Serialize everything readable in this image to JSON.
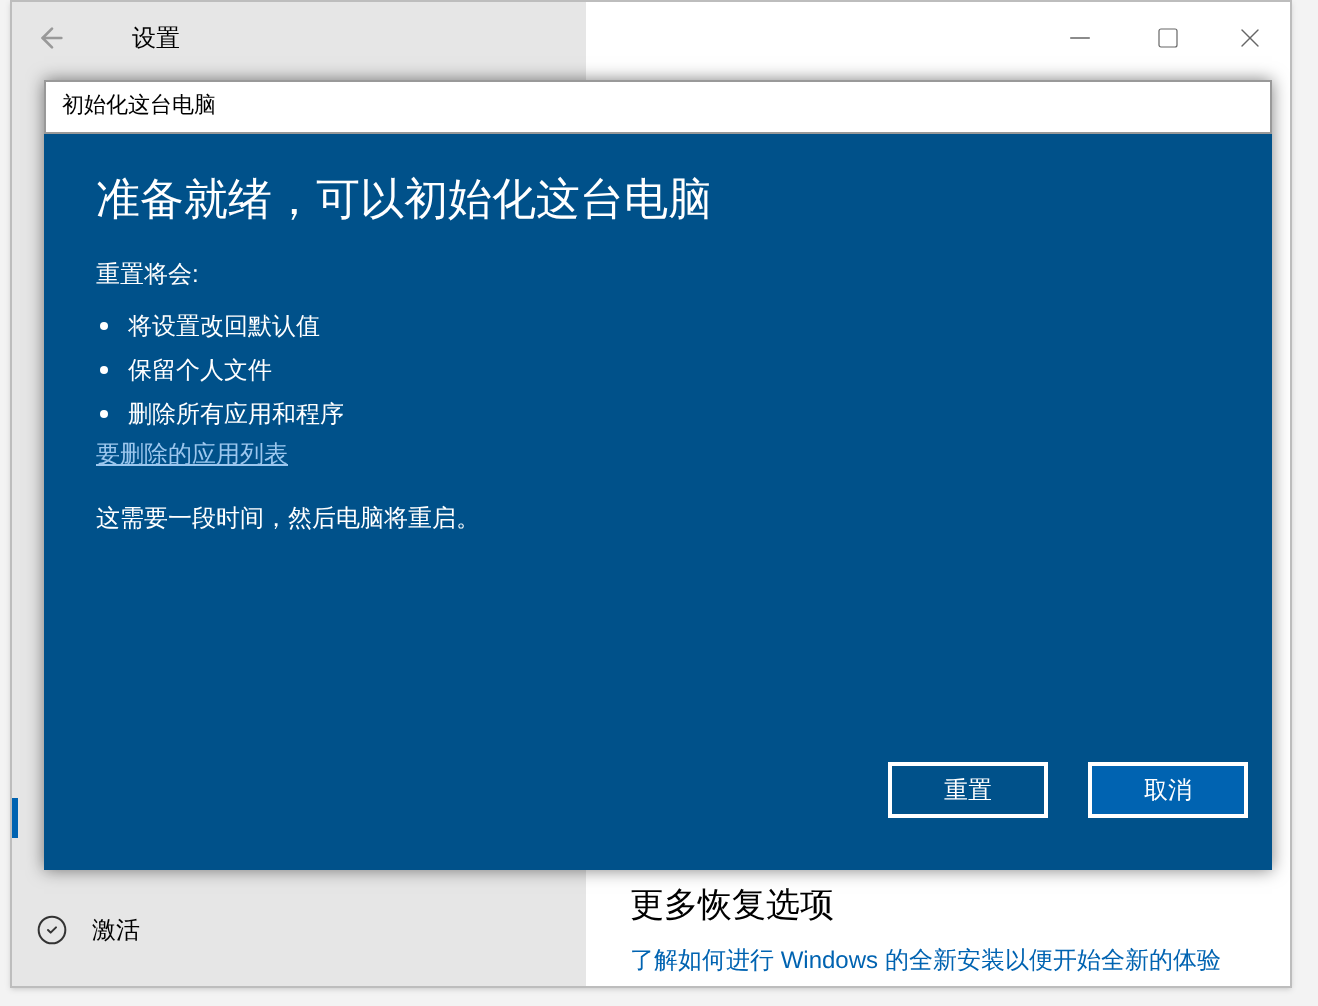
{
  "window": {
    "title": "设置"
  },
  "sidebar": {
    "items": [
      {
        "label": "激活",
        "selected": false
      }
    ]
  },
  "content": {
    "heading": "更多恢复选项",
    "link": "了解如何进行 Windows 的全新安装以便开始全新的体验"
  },
  "dialog": {
    "title": "初始化这台电脑",
    "heading": "准备就绪，可以初始化这台电脑",
    "intro": "重置将会:",
    "bullets": [
      "将设置改回默认值",
      "保留个人文件",
      "删除所有应用和程序"
    ],
    "link": "要删除的应用列表",
    "note": "这需要一段时间，然后电脑将重启。",
    "buttons": [
      {
        "label": "重置",
        "kind": "outline"
      },
      {
        "label": "取消",
        "kind": "primary"
      }
    ]
  }
}
